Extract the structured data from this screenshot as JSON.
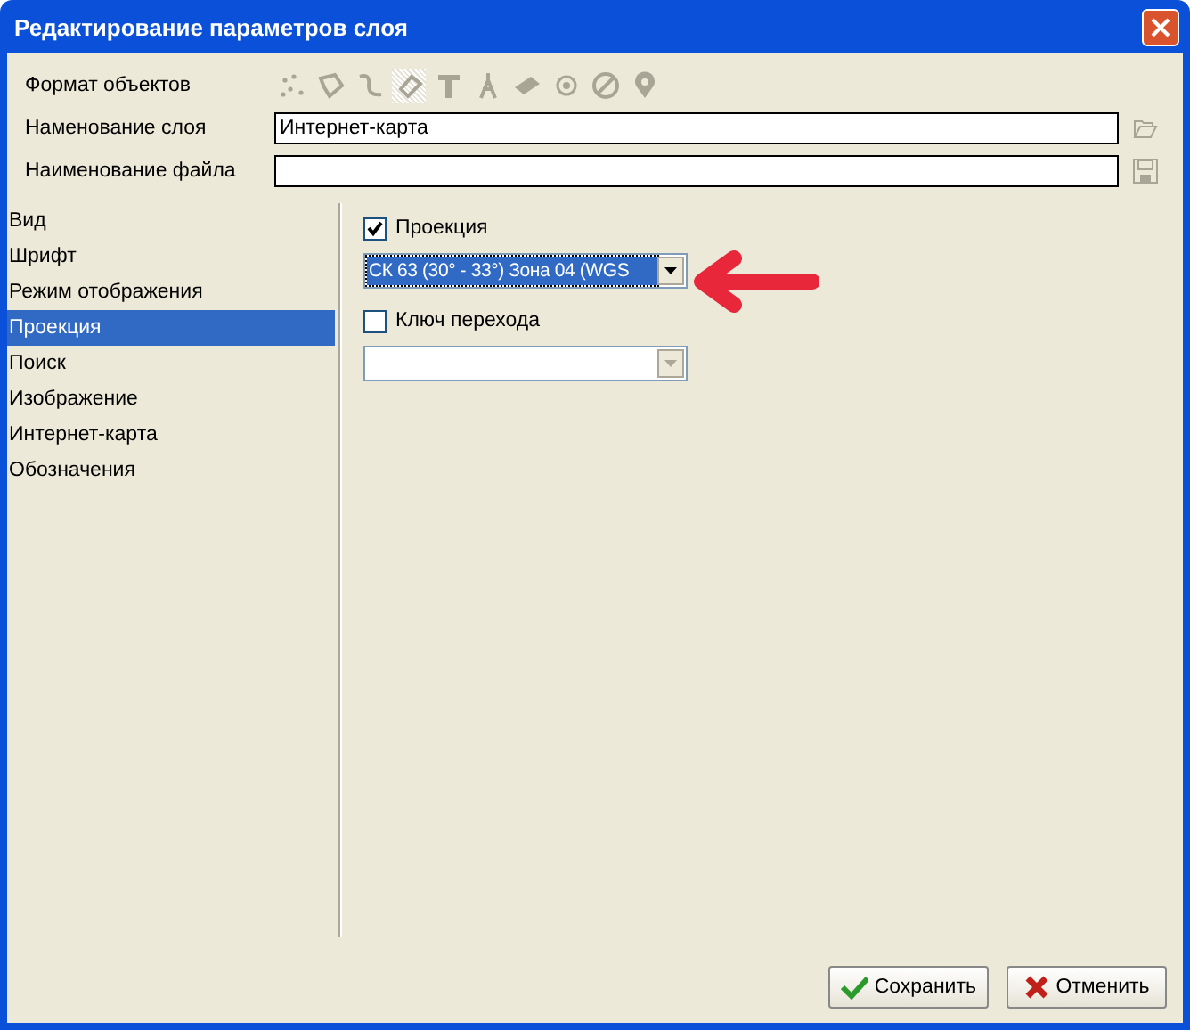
{
  "window": {
    "title": "Редактирование параметров слоя"
  },
  "format": {
    "label": "Формат объектов",
    "tools": [
      {
        "selected": false
      },
      {
        "selected": false
      },
      {
        "selected": false
      },
      {
        "selected": true
      },
      {
        "selected": false
      },
      {
        "selected": false
      },
      {
        "selected": false
      },
      {
        "selected": false
      },
      {
        "selected": false
      },
      {
        "selected": false
      }
    ]
  },
  "layer_name": {
    "label": "Наменование слоя",
    "value": "Интернет-карта"
  },
  "file_name": {
    "label": "Наименование файла"
  },
  "sidebar": {
    "items": [
      {
        "label": "Вид",
        "selected": false
      },
      {
        "label": "Шрифт",
        "selected": false
      },
      {
        "label": "Режим отображения",
        "selected": false
      },
      {
        "label": "Проекция",
        "selected": true
      },
      {
        "label": "Поиск",
        "selected": false
      },
      {
        "label": "Изображение",
        "selected": false
      },
      {
        "label": "Интернет-карта",
        "selected": false
      },
      {
        "label": "Обозначения",
        "selected": false
      }
    ]
  },
  "panel": {
    "items": [
      {
        "label": "Проекция",
        "checked": true,
        "combo": {
          "value": "СК 63 (30° - 33°) Зона 04 (WGS",
          "disabled": false
        }
      },
      {
        "label": "Ключ перехода",
        "checked": false,
        "combo": {
          "disabled": true
        }
      }
    ]
  },
  "buttons": [
    {
      "kind": "save",
      "label": "Сохранить"
    },
    {
      "kind": "cancel",
      "label": "Отменить"
    }
  ]
}
